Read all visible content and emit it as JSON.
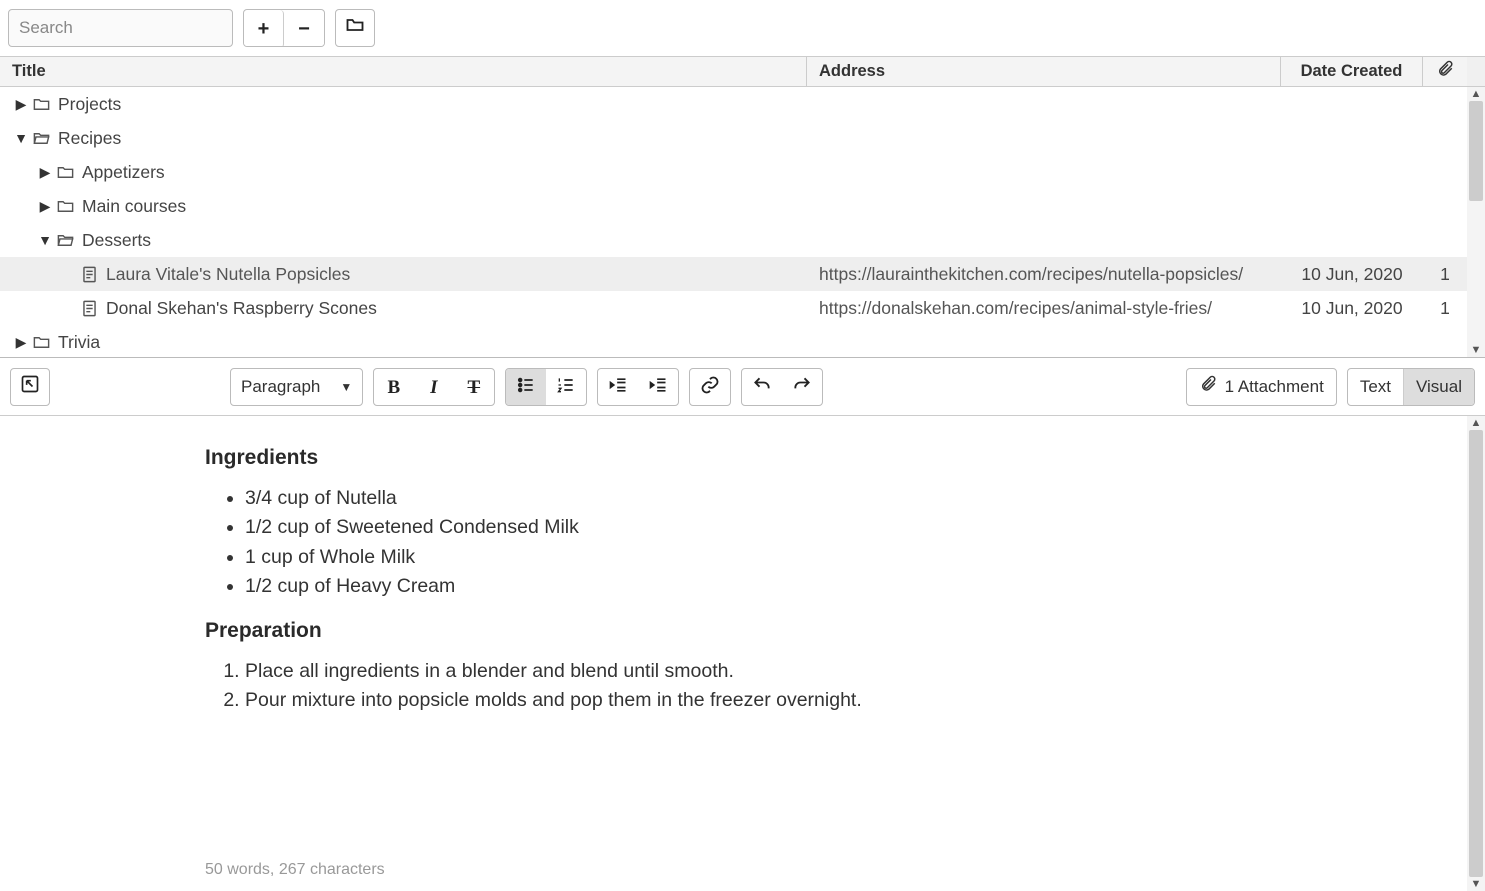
{
  "toolbar": {
    "search_placeholder": "Search",
    "plus_label": "+",
    "minus_label": "−"
  },
  "table": {
    "headers": {
      "title": "Title",
      "address": "Address",
      "date": "Date Created"
    },
    "rows": [
      {
        "depth": 0,
        "caret": "right",
        "icon": "folder",
        "label": "Projects",
        "address": "",
        "date": "",
        "att": ""
      },
      {
        "depth": 0,
        "caret": "down",
        "icon": "folder-open",
        "label": "Recipes",
        "address": "",
        "date": "",
        "att": ""
      },
      {
        "depth": 1,
        "caret": "right",
        "icon": "folder",
        "label": "Appetizers",
        "address": "",
        "date": "",
        "att": ""
      },
      {
        "depth": 1,
        "caret": "right",
        "icon": "folder",
        "label": "Main courses",
        "address": "",
        "date": "",
        "att": ""
      },
      {
        "depth": 1,
        "caret": "down",
        "icon": "folder-open",
        "label": "Desserts",
        "address": "",
        "date": "",
        "att": ""
      },
      {
        "depth": 2,
        "caret": "",
        "icon": "page",
        "label": "Laura Vitale's Nutella Popsicles",
        "address": "https://laurainthekitchen.com/recipes/nutella-popsicles/",
        "date": "10 Jun, 2020",
        "att": "1",
        "selected": true
      },
      {
        "depth": 2,
        "caret": "",
        "icon": "page",
        "label": "Donal Skehan's Raspberry Scones",
        "address": "https://donalskehan.com/recipes/animal-style-fries/",
        "date": "10 Jun, 2020",
        "att": "1"
      },
      {
        "depth": 0,
        "caret": "right",
        "icon": "folder",
        "label": "Trivia",
        "address": "",
        "date": "",
        "att": ""
      }
    ]
  },
  "editor": {
    "style_label": "Paragraph",
    "attachment_label": "1 Attachment",
    "view_text_label": "Text",
    "view_visual_label": "Visual",
    "heading_ingredients": "Ingredients",
    "ingredients": [
      "3/4 cup of Nutella",
      "1/2 cup of Sweetened Condensed Milk",
      "1 cup of Whole Milk",
      "1/2 cup of Heavy Cream"
    ],
    "heading_preparation": "Preparation",
    "steps": [
      "Place all ingredients in a blender and blend until smooth.",
      "Pour mixture into popsicle molds and pop them in the freezer overnight."
    ],
    "status": "50 words, 267 characters"
  }
}
